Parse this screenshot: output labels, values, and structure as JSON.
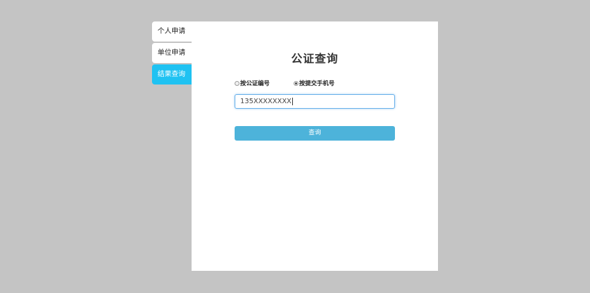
{
  "sidebar": {
    "tabs": [
      {
        "label": "个人申请",
        "active": false
      },
      {
        "label": "单位申请",
        "active": false
      },
      {
        "label": "结果查询",
        "active": true
      }
    ]
  },
  "main": {
    "title": "公证查询",
    "radio_options": [
      {
        "label": "按公证编号",
        "checked": false
      },
      {
        "label": "按提交手机号",
        "checked": true
      }
    ],
    "phone_input": {
      "value": "135XXXXXXXX"
    },
    "query_button_label": "查询"
  },
  "colors": {
    "background": "#c4c4c4",
    "active_tab": "#1fc2f2",
    "button": "#4db3da",
    "input_focus_border": "#66afe9"
  }
}
